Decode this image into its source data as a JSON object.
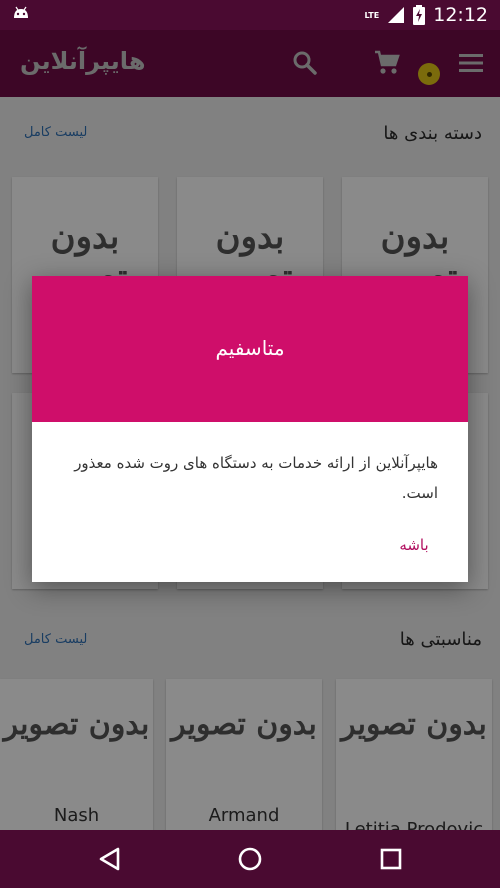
{
  "status_bar": {
    "time": "12:12",
    "network": "LTE"
  },
  "app_bar": {
    "brand": "هایپرآنلاین",
    "accent": "#6f0b46"
  },
  "categories": {
    "title": "دسته بندی ها",
    "link": "لیست کامل",
    "placeholder": "بدون تصویر"
  },
  "occasions": {
    "title": "مناسبتی ها",
    "link": "لیست کامل",
    "placeholder": "بدون تصویر",
    "items": [
      {
        "name": "Nash"
      },
      {
        "name": "Armand"
      },
      {
        "name": "Letitia Prodovic"
      }
    ]
  },
  "dialog": {
    "title": "متاسفیم",
    "message": "هایپرآنلاین از ارائه خدمات به دستگاه های روت شده معذور است.",
    "ok_label": "باشه",
    "header_color": "#cf0e6a"
  },
  "nav_bar": {
    "back_icon": "back-triangle-icon",
    "home_icon": "home-circle-icon",
    "recents_icon": "recents-square-icon"
  }
}
